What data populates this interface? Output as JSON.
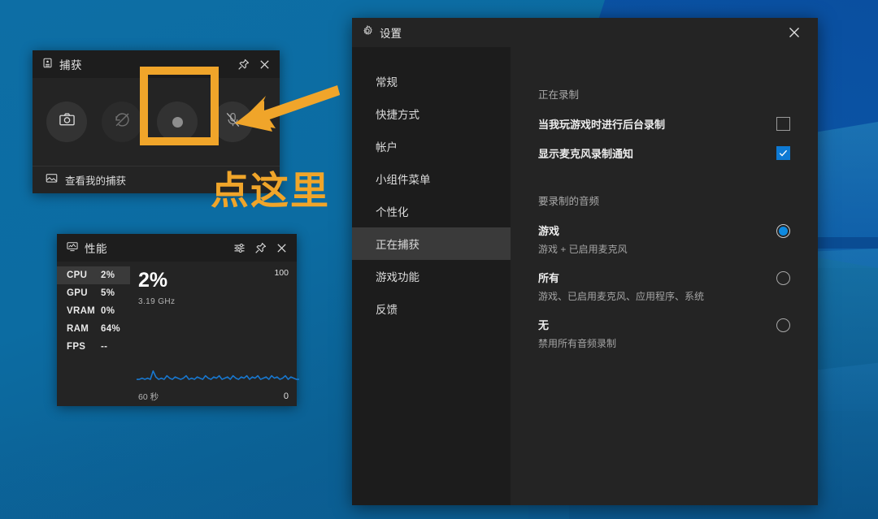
{
  "capture_widget": {
    "title": "捕获",
    "title_icon": "capture-icon",
    "pin_icon": "pin-icon",
    "close_icon": "close-icon",
    "buttons": [
      {
        "name": "screenshot",
        "icon": "camera-icon"
      },
      {
        "name": "record-last-30s",
        "icon": "record-last-disabled-icon"
      },
      {
        "name": "start-recording",
        "icon": "record-dot-icon"
      },
      {
        "name": "toggle-microphone",
        "icon": "microphone-muted-icon"
      }
    ],
    "footer_label": "查看我的捕获",
    "footer_icon": "gallery-icon"
  },
  "performance_widget": {
    "title": "性能",
    "title_icon": "performance-icon",
    "settings_icon": "sliders-icon",
    "pin_icon": "pin-icon",
    "close_icon": "close-icon",
    "metrics": [
      {
        "key": "CPU",
        "value": "2%",
        "selected": true
      },
      {
        "key": "GPU",
        "value": "5%",
        "selected": false
      },
      {
        "key": "VRAM",
        "value": "0%",
        "selected": false
      },
      {
        "key": "RAM",
        "value": "64%",
        "selected": false
      },
      {
        "key": "FPS",
        "value": "--",
        "selected": false
      }
    ],
    "big_value": "2%",
    "sub_value": "3.19 GHz",
    "axis_max": "100",
    "axis_min": "0",
    "time_span": "60 秒",
    "line_color": "#1878d0"
  },
  "settings_window": {
    "title": "设置",
    "title_icon": "gear-icon",
    "close_icon": "close-icon",
    "nav_items": [
      {
        "label": "常规",
        "active": false
      },
      {
        "label": "快捷方式",
        "active": false
      },
      {
        "label": "帐户",
        "active": false
      },
      {
        "label": "小组件菜单",
        "active": false
      },
      {
        "label": "个性化",
        "active": false
      },
      {
        "label": "正在捕获",
        "active": true
      },
      {
        "label": "游戏功能",
        "active": false
      },
      {
        "label": "反馈",
        "active": false
      }
    ],
    "sections": [
      {
        "heading": "正在录制",
        "options": [
          {
            "name": "当我玩游戏时进行后台录制",
            "desc": "",
            "control": "checkbox",
            "checked": false
          },
          {
            "name": "显示麦克风录制通知",
            "desc": "",
            "control": "checkbox",
            "checked": true
          }
        ]
      },
      {
        "heading": "要录制的音频",
        "options": [
          {
            "name": "游戏",
            "desc": "游戏 + 已启用麦克风",
            "control": "radio",
            "checked": true
          },
          {
            "name": "所有",
            "desc": "游戏、已启用麦克风、应用程序、系统",
            "control": "radio",
            "checked": false
          },
          {
            "name": "无",
            "desc": "禁用所有音频录制",
            "control": "radio",
            "checked": false
          }
        ]
      }
    ]
  },
  "annotation": {
    "text": "点这里",
    "color": "#f0a52a",
    "arrow": "arrow-pointing-left-down",
    "highlight_target": "start-recording"
  },
  "chart_data": {
    "type": "line",
    "title": "CPU",
    "ylabel": "",
    "xlabel": "60 秒",
    "ylim": [
      0,
      100
    ],
    "series": [
      {
        "name": "CPU %",
        "values": [
          2,
          2,
          3,
          2,
          3,
          2,
          9,
          4,
          2,
          3,
          2,
          5,
          3,
          2,
          4,
          3,
          2,
          3,
          5,
          2,
          3,
          2,
          4,
          3,
          2,
          5,
          3,
          2,
          4,
          3,
          5,
          2,
          3,
          4,
          2,
          5,
          3,
          2,
          4,
          3,
          5,
          2,
          4,
          3,
          5,
          2,
          3,
          4,
          2,
          5,
          3,
          4,
          2,
          3,
          5,
          2,
          4,
          3,
          2,
          2
        ]
      }
    ]
  }
}
